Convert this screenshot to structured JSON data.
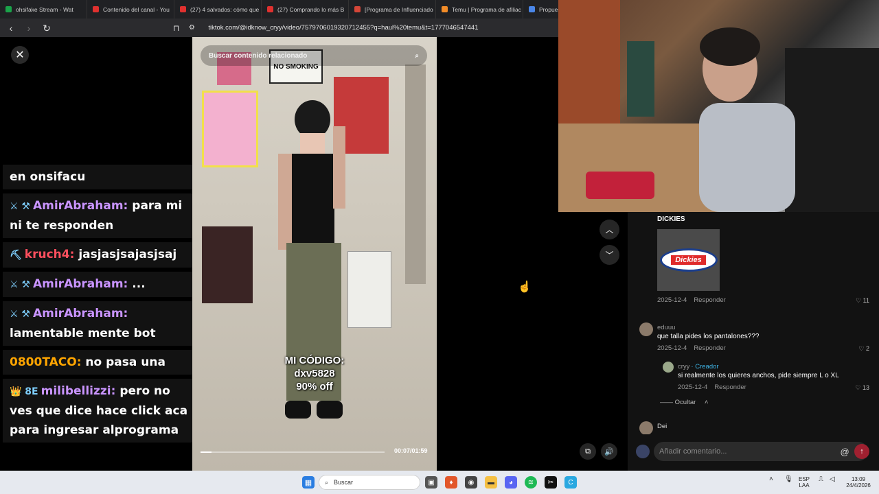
{
  "tabs": [
    {
      "label": "ohsifake Stream - Wat",
      "color": "#1aa34a"
    },
    {
      "label": "Contenido del canal - You",
      "color": "#e0312f"
    },
    {
      "label": "(27) 4 salvados: cómo que",
      "color": "#e0312f"
    },
    {
      "label": "(27) Comprando lo más B",
      "color": "#e0312f"
    },
    {
      "label": "[Programa de Influenciado",
      "color": "#d44638"
    },
    {
      "label": "Temu | Programa de afiliac",
      "color": "#f28c28"
    },
    {
      "label": "Propues",
      "color": "#4a86e8"
    }
  ],
  "address": {
    "url": "tiktok.com/@idknow_cryy/video/7579706019320712455?q=haul%20temu&t=1777046547441"
  },
  "video": {
    "search_placeholder": "Buscar contenido relacionado",
    "promo_line1": "MI CÓDIGO:",
    "promo_line2": "dxv5828",
    "promo_line3": "90% off",
    "time": "00:07/01:59",
    "progress": 0.06,
    "sign_text": "NO SMOKING"
  },
  "chat": [
    {
      "user": "",
      "text": "en onsifacu",
      "color": "#ffffff",
      "badge": ""
    },
    {
      "user": "AmirAbraham",
      "text": " para mi ni te responden",
      "color": "#c994ff",
      "badge": "⚔ ⚒"
    },
    {
      "user": "kruch4",
      "text": " jasjasjsajasjsaj",
      "color": "#ff4f5e",
      "badge": "⛏"
    },
    {
      "user": "AmirAbraham",
      "text": " ...",
      "color": "#c994ff",
      "badge": "⚔ ⚒"
    },
    {
      "user": "AmirAbraham",
      "text": " lamentable mente bot",
      "color": "#c994ff",
      "badge": "⚔ ⚒"
    },
    {
      "user": "0800TACO",
      "text": " no pasa una",
      "color": "#ffa500",
      "badge": ""
    },
    {
      "user": "milibellizzi",
      "text": " pero no ves que dice hace click aca para ingresar alprograma",
      "color": "#c994ff",
      "badge": "👑 8E"
    }
  ],
  "comments": {
    "truncated_top": "DICKIES",
    "c1": {
      "date": "2025-12-4",
      "reply": "Responder",
      "likes": "11",
      "image_label": "Dickies"
    },
    "c2": {
      "user": "eduuu",
      "text": "que talla pides los pantalones???",
      "date": "2025-12-4",
      "reply": "Responder",
      "likes": "2"
    },
    "c3": {
      "user": "cryy",
      "creator": "· Creador",
      "text": "si realmente los quieres anchos, pide siempre L o XL",
      "date": "2025-12-4",
      "reply": "Responder",
      "likes": "13"
    },
    "hide": "Ocultar",
    "c4": {
      "user": "Dei"
    },
    "input_placeholder": "Añadir comentario..."
  },
  "taskbar": {
    "search": "Buscar",
    "lang1": "ESP",
    "lang2": "LAA",
    "clock": "13:09",
    "date": "24/4/2026"
  }
}
